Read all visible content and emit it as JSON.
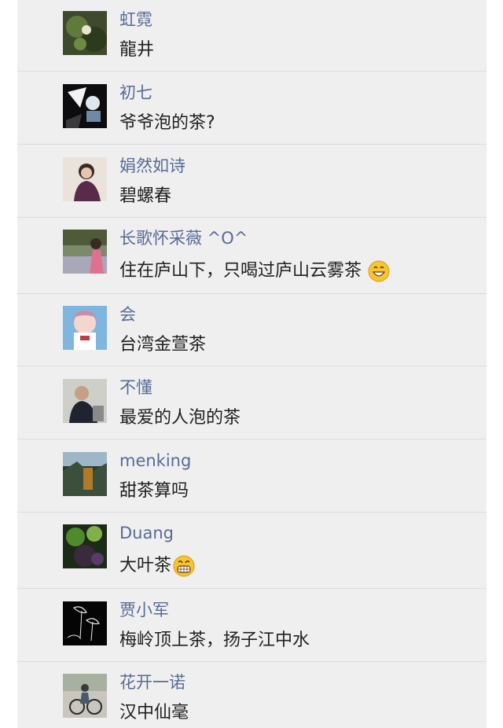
{
  "comments": [
    {
      "name": "虹霓",
      "text": "龍井"
    },
    {
      "name": "初七",
      "text": "爷爷泡的茶?"
    },
    {
      "name": "娟然如诗",
      "text": "碧螺春"
    },
    {
      "name": "长歌怀采薇 ^O^",
      "text": "住在庐山下，只喝过庐山云雾茶",
      "emoji": "grin-emoji"
    },
    {
      "name": "会",
      "text": "台湾金萱茶"
    },
    {
      "name": "不懂",
      "text": "最爱的人泡的茶"
    },
    {
      "name": "menking",
      "text": "甜茶算吗"
    },
    {
      "name": "Duang",
      "text": "大叶茶",
      "emoji": "big-grin-emoji"
    },
    {
      "name": "贾小军",
      "text": "梅岭顶上茶，扬子江中水"
    },
    {
      "name": "花开一诺",
      "text": "汉中仙毫"
    }
  ],
  "colors": {
    "background": "#efeff0",
    "name": "#586b94",
    "text": "#1f1f1f",
    "divider": "#dcdcdf"
  }
}
